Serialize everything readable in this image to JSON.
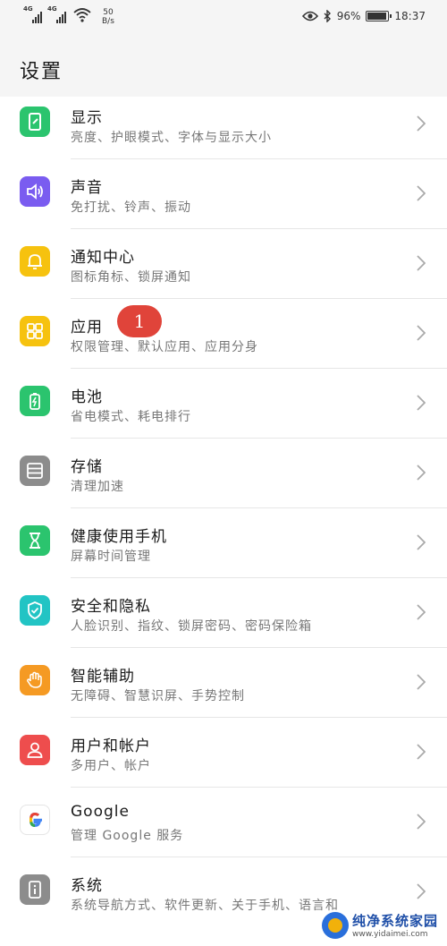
{
  "status_bar": {
    "network_1": "4G",
    "network_2": "4G",
    "speed_value": "50",
    "speed_unit": "B/s",
    "battery": "96%",
    "time": "18:37",
    "battery_level": 0.96
  },
  "header": {
    "title": "设置"
  },
  "settings": [
    {
      "title": "显示",
      "subtitle": "亮度、护眼模式、字体与显示大小",
      "icon": "display-icon",
      "color": "#2bc46e"
    },
    {
      "title": "声音",
      "subtitle": "免打扰、铃声、振动",
      "icon": "speaker-icon",
      "color": "#7a5cf0"
    },
    {
      "title": "通知中心",
      "subtitle": "图标角标、锁屏通知",
      "icon": "bell-icon",
      "color": "#f6c20f"
    },
    {
      "title": "应用",
      "subtitle": "权限管理、默认应用、应用分身",
      "icon": "apps-icon",
      "color": "#f6c20f"
    },
    {
      "title": "电池",
      "subtitle": "省电模式、耗电排行",
      "icon": "battery-icon",
      "color": "#2bc46e"
    },
    {
      "title": "存储",
      "subtitle": "清理加速",
      "icon": "storage-icon",
      "color": "#8c8c8c"
    },
    {
      "title": "健康使用手机",
      "subtitle": "屏幕时间管理",
      "icon": "hourglass-icon",
      "color": "#2bc46e"
    },
    {
      "title": "安全和隐私",
      "subtitle": "人脸识别、指纹、锁屏密码、密码保险箱",
      "icon": "shield-icon",
      "color": "#22c4c4"
    },
    {
      "title": "智能辅助",
      "subtitle": "无障碍、智慧识屏、手势控制",
      "icon": "hand-icon",
      "color": "#f59a23"
    },
    {
      "title": "用户和帐户",
      "subtitle": "多用户、帐户",
      "icon": "user-icon",
      "color": "#ee4d4d"
    },
    {
      "title": "Google",
      "subtitle": "管理 Google 服务",
      "icon": "google-icon",
      "color": "#ffffff"
    },
    {
      "title": "系统",
      "subtitle": "系统导航方式、软件更新、关于手机、语言和",
      "icon": "info-icon",
      "color": "#8c8c8c"
    }
  ],
  "annotation": {
    "step": "1",
    "color": "#e0443a"
  },
  "watermark": {
    "name": "纯净系统家园",
    "url": "www.yidaimei.com"
  }
}
